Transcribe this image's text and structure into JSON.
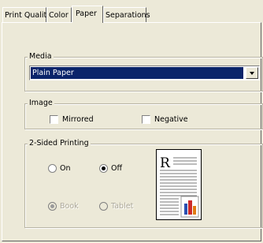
{
  "tabs": [
    {
      "label": "Print Quality",
      "active": false
    },
    {
      "label": "Color",
      "active": false
    },
    {
      "label": "Paper",
      "active": true
    },
    {
      "label": "Separations",
      "active": false
    }
  ],
  "media": {
    "group_label": "Media",
    "selected": "Plain Paper"
  },
  "image": {
    "group_label": "Image",
    "mirrored_label": "Mirrored",
    "mirrored_checked": false,
    "negative_label": "Negative",
    "negative_checked": false
  },
  "two_sided": {
    "group_label": "2-Sided Printing",
    "on_label": "On",
    "off_label": "Off",
    "selected": "Off",
    "book_label": "Book",
    "tablet_label": "Tablet",
    "binding_selected": "Book",
    "preview_letter": "R"
  },
  "colors": {
    "selection": "#0a246a",
    "chart_red": "#cc2a2a",
    "chart_blue": "#2b4fb0",
    "chart_orange": "#e07a12"
  }
}
